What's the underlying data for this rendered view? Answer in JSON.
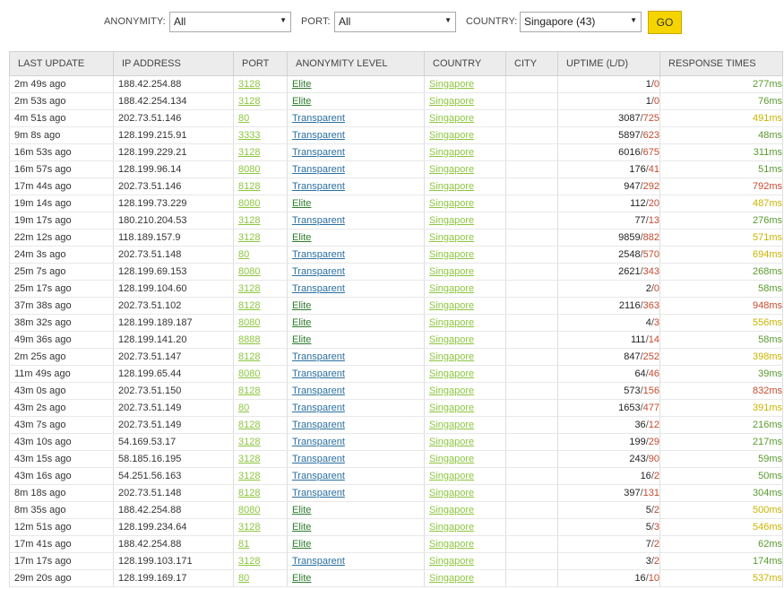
{
  "filters": {
    "anonymity_label": "ANONYMITY:",
    "anonymity_value": "All",
    "port_label": "PORT:",
    "port_value": "All",
    "country_label": "COUNTRY:",
    "country_value": "Singapore (43)",
    "go_label": "GO"
  },
  "colors": {
    "go_button": "#f5d400",
    "port_link": "#8dc63f",
    "anonymity_link": "#2a6fa0",
    "elite_link": "#2e7d2e",
    "uptime_down": "#c44b2f",
    "speed_fast": "#5a9a2e",
    "speed_mid": "#c9b400",
    "speed_slow": "#c44b2f"
  },
  "table": {
    "headers": [
      "LAST UPDATE",
      "IP ADDRESS",
      "PORT",
      "ANONYMITY LEVEL",
      "COUNTRY",
      "CITY",
      "UPTIME (L/D)",
      "RESPONSE TIMES"
    ],
    "rows": [
      {
        "update": "2m 49s ago",
        "ip": "188.42.254.88",
        "port": "3128",
        "anon": "Elite",
        "country": "Singapore",
        "city": "",
        "up": "1",
        "down": "0",
        "resp": "277ms",
        "speed": "fast"
      },
      {
        "update": "2m 53s ago",
        "ip": "188.42.254.134",
        "port": "3128",
        "anon": "Elite",
        "country": "Singapore",
        "city": "",
        "up": "1",
        "down": "0",
        "resp": "76ms",
        "speed": "fast"
      },
      {
        "update": "4m 51s ago",
        "ip": "202.73.51.146",
        "port": "80",
        "anon": "Transparent",
        "country": "Singapore",
        "city": "",
        "up": "3087",
        "down": "725",
        "resp": "491ms",
        "speed": "mid"
      },
      {
        "update": "9m 8s ago",
        "ip": "128.199.215.91",
        "port": "3333",
        "anon": "Transparent",
        "country": "Singapore",
        "city": "",
        "up": "5897",
        "down": "623",
        "resp": "48ms",
        "speed": "fast"
      },
      {
        "update": "16m 53s ago",
        "ip": "128.199.229.21",
        "port": "3128",
        "anon": "Transparent",
        "country": "Singapore",
        "city": "",
        "up": "6016",
        "down": "675",
        "resp": "311ms",
        "speed": "fast"
      },
      {
        "update": "16m 57s ago",
        "ip": "128.199.96.14",
        "port": "8080",
        "anon": "Transparent",
        "country": "Singapore",
        "city": "",
        "up": "176",
        "down": "41",
        "resp": "51ms",
        "speed": "fast"
      },
      {
        "update": "17m 44s ago",
        "ip": "202.73.51.146",
        "port": "8128",
        "anon": "Transparent",
        "country": "Singapore",
        "city": "",
        "up": "947",
        "down": "292",
        "resp": "792ms",
        "speed": "slow"
      },
      {
        "update": "19m 14s ago",
        "ip": "128.199.73.229",
        "port": "8080",
        "anon": "Elite",
        "country": "Singapore",
        "city": "",
        "up": "112",
        "down": "20",
        "resp": "487ms",
        "speed": "mid"
      },
      {
        "update": "19m 17s ago",
        "ip": "180.210.204.53",
        "port": "3128",
        "anon": "Transparent",
        "country": "Singapore",
        "city": "",
        "up": "77",
        "down": "13",
        "resp": "276ms",
        "speed": "fast"
      },
      {
        "update": "22m 12s ago",
        "ip": "118.189.157.9",
        "port": "3128",
        "anon": "Elite",
        "country": "Singapore",
        "city": "",
        "up": "9859",
        "down": "882",
        "resp": "571ms",
        "speed": "mid"
      },
      {
        "update": "24m 3s ago",
        "ip": "202.73.51.148",
        "port": "80",
        "anon": "Transparent",
        "country": "Singapore",
        "city": "",
        "up": "2548",
        "down": "570",
        "resp": "694ms",
        "speed": "mid"
      },
      {
        "update": "25m 7s ago",
        "ip": "128.199.69.153",
        "port": "8080",
        "anon": "Transparent",
        "country": "Singapore",
        "city": "",
        "up": "2621",
        "down": "343",
        "resp": "268ms",
        "speed": "fast"
      },
      {
        "update": "25m 17s ago",
        "ip": "128.199.104.60",
        "port": "3128",
        "anon": "Transparent",
        "country": "Singapore",
        "city": "",
        "up": "2",
        "down": "0",
        "resp": "58ms",
        "speed": "fast"
      },
      {
        "update": "37m 38s ago",
        "ip": "202.73.51.102",
        "port": "8128",
        "anon": "Elite",
        "country": "Singapore",
        "city": "",
        "up": "2116",
        "down": "363",
        "resp": "948ms",
        "speed": "slow"
      },
      {
        "update": "38m 32s ago",
        "ip": "128.199.189.187",
        "port": "8080",
        "anon": "Elite",
        "country": "Singapore",
        "city": "",
        "up": "4",
        "down": "3",
        "resp": "556ms",
        "speed": "mid"
      },
      {
        "update": "49m 36s ago",
        "ip": "128.199.141.20",
        "port": "8888",
        "anon": "Elite",
        "country": "Singapore",
        "city": "",
        "up": "111",
        "down": "14",
        "resp": "58ms",
        "speed": "fast"
      },
      {
        "update": "2m 25s ago",
        "ip": "202.73.51.147",
        "port": "8128",
        "anon": "Transparent",
        "country": "Singapore",
        "city": "",
        "up": "847",
        "down": "252",
        "resp": "398ms",
        "speed": "mid"
      },
      {
        "update": "11m 49s ago",
        "ip": "128.199.65.44",
        "port": "8080",
        "anon": "Transparent",
        "country": "Singapore",
        "city": "",
        "up": "64",
        "down": "46",
        "resp": "39ms",
        "speed": "fast"
      },
      {
        "update": "43m 0s ago",
        "ip": "202.73.51.150",
        "port": "8128",
        "anon": "Transparent",
        "country": "Singapore",
        "city": "",
        "up": "573",
        "down": "156",
        "resp": "832ms",
        "speed": "slow"
      },
      {
        "update": "43m 2s ago",
        "ip": "202.73.51.149",
        "port": "80",
        "anon": "Transparent",
        "country": "Singapore",
        "city": "",
        "up": "1653",
        "down": "477",
        "resp": "391ms",
        "speed": "mid"
      },
      {
        "update": "43m 7s ago",
        "ip": "202.73.51.149",
        "port": "8128",
        "anon": "Transparent",
        "country": "Singapore",
        "city": "",
        "up": "36",
        "down": "12",
        "resp": "216ms",
        "speed": "fast"
      },
      {
        "update": "43m 10s ago",
        "ip": "54.169.53.17",
        "port": "3128",
        "anon": "Transparent",
        "country": "Singapore",
        "city": "",
        "up": "199",
        "down": "29",
        "resp": "217ms",
        "speed": "fast"
      },
      {
        "update": "43m 15s ago",
        "ip": "58.185.16.195",
        "port": "3128",
        "anon": "Transparent",
        "country": "Singapore",
        "city": "",
        "up": "243",
        "down": "90",
        "resp": "59ms",
        "speed": "fast"
      },
      {
        "update": "43m 16s ago",
        "ip": "54.251.56.163",
        "port": "3128",
        "anon": "Transparent",
        "country": "Singapore",
        "city": "",
        "up": "16",
        "down": "2",
        "resp": "50ms",
        "speed": "fast"
      },
      {
        "update": "8m 18s ago",
        "ip": "202.73.51.148",
        "port": "8128",
        "anon": "Transparent",
        "country": "Singapore",
        "city": "",
        "up": "397",
        "down": "131",
        "resp": "304ms",
        "speed": "fast"
      },
      {
        "update": "8m 35s ago",
        "ip": "188.42.254.88",
        "port": "8080",
        "anon": "Elite",
        "country": "Singapore",
        "city": "",
        "up": "5",
        "down": "2",
        "resp": "500ms",
        "speed": "mid"
      },
      {
        "update": "12m 51s ago",
        "ip": "128.199.234.64",
        "port": "3128",
        "anon": "Elite",
        "country": "Singapore",
        "city": "",
        "up": "5",
        "down": "3",
        "resp": "546ms",
        "speed": "mid"
      },
      {
        "update": "17m 41s ago",
        "ip": "188.42.254.88",
        "port": "81",
        "anon": "Elite",
        "country": "Singapore",
        "city": "",
        "up": "7",
        "down": "2",
        "resp": "62ms",
        "speed": "fast"
      },
      {
        "update": "17m 17s ago",
        "ip": "128.199.103.171",
        "port": "3128",
        "anon": "Transparent",
        "country": "Singapore",
        "city": "",
        "up": "3",
        "down": "2",
        "resp": "174ms",
        "speed": "fast"
      },
      {
        "update": "29m 20s ago",
        "ip": "128.199.169.17",
        "port": "80",
        "anon": "Elite",
        "country": "Singapore",
        "city": "",
        "up": "16",
        "down": "10",
        "resp": "537ms",
        "speed": "mid"
      }
    ]
  }
}
